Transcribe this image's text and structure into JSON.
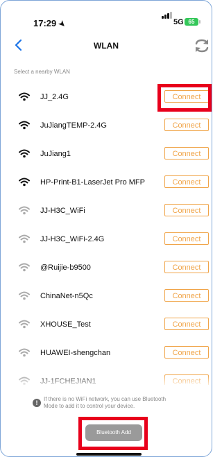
{
  "status_bar": {
    "time": "17:29",
    "network": "5G",
    "battery": "65"
  },
  "header": {
    "title": "WLAN"
  },
  "section_label": "Select a nearby WLAN",
  "networks": [
    {
      "ssid": "JJ_2.4G",
      "signal": "strong",
      "action": "Connect"
    },
    {
      "ssid": "JuJiangTEMP-2.4G",
      "signal": "strong",
      "action": "Connect"
    },
    {
      "ssid": "JuJiang1",
      "signal": "strong",
      "action": "Connect"
    },
    {
      "ssid": "HP-Print-B1-LaserJet Pro MFP",
      "signal": "strong",
      "action": "Connect"
    },
    {
      "ssid": "JJ-H3C_WiFi",
      "signal": "weak",
      "action": "Connect"
    },
    {
      "ssid": "JJ-H3C_WiFi-2.4G",
      "signal": "weak",
      "action": "Connect"
    },
    {
      "ssid": "@Ruijie-b9500",
      "signal": "weak",
      "action": "Connect"
    },
    {
      "ssid": "ChinaNet-n5Qc",
      "signal": "weak",
      "action": "Connect"
    },
    {
      "ssid": "XHOUSE_Test",
      "signal": "weak",
      "action": "Connect"
    },
    {
      "ssid": "HUAWEI-shengchan",
      "signal": "weak",
      "action": "Connect"
    },
    {
      "ssid": "JJ-1FCHEJIAN1",
      "signal": "weak",
      "action": "Connect"
    }
  ],
  "footer": {
    "info_text": "If there is no WiFi network, you can use Bluetooth Mode to add it to control your device.",
    "bluetooth_button": "Bluetooth Add"
  },
  "colors": {
    "accent": "#f0a448",
    "highlight": "#e8001b",
    "back_arrow": "#1a73e8"
  }
}
